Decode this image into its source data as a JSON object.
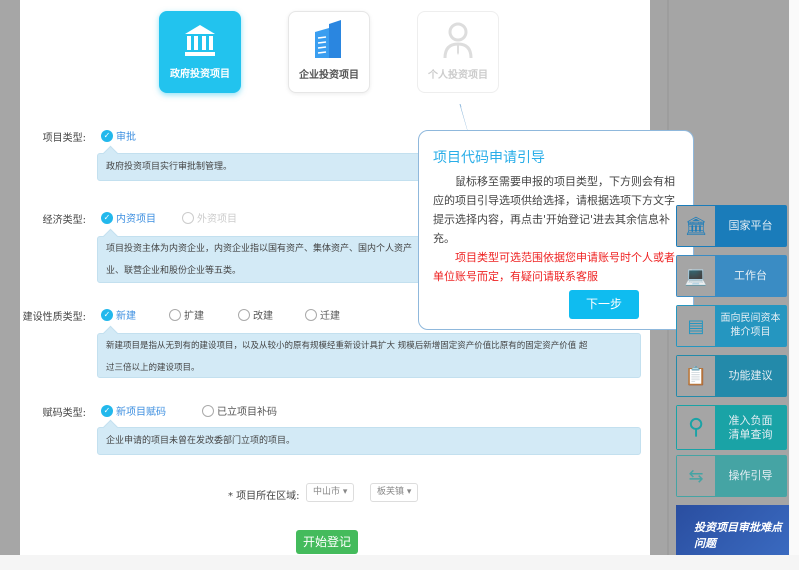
{
  "cards": [
    {
      "label": "政府投资项目",
      "icon": "government-building-icon",
      "active": true
    },
    {
      "label": "企业投资项目",
      "icon": "office-building-icon",
      "active": false
    },
    {
      "label": "个人投资项目",
      "icon": "person-icon",
      "active": false,
      "disabled": true
    }
  ],
  "form": {
    "project_type": {
      "label": "项目类型:",
      "options": [
        "审批"
      ],
      "selected": "审批",
      "desc": "政府投资项目实行审批制管理。"
    },
    "economy_type": {
      "label": "经济类型:",
      "options": [
        "内资项目",
        "外资项目"
      ],
      "selected": "内资项目",
      "desc_line1": "项目投资主体为内资企业，内资企业指以国有资产、集体资产、国内个人资产",
      "desc_line2": "业、联营企业和股份企业等五类。"
    },
    "construction_type": {
      "label": "建设性质类型:",
      "options": [
        "新建",
        "扩建",
        "改建",
        "迁建"
      ],
      "selected": "新建",
      "desc_line1": "新建项目是指从无到有的建设项目，以及从较小的原有规模经重新设计具扩大 规模后新增固定资产价值比原有的固定资产价值 超",
      "desc_line2": "过三倍以上的建设项目。"
    },
    "code_type": {
      "label": "赋码类型:",
      "options": [
        "新项目赋码",
        "已立项目补码"
      ],
      "selected": "新项目赋码",
      "desc": "企业申请的项目未曾在发改委部门立项的项目。"
    },
    "region": {
      "label": "* 项目所在区域:",
      "city": "中山市",
      "town": "板芙镇"
    },
    "start_button": "开始登记"
  },
  "popover": {
    "title": "项目代码申请引导",
    "body": "鼠标移至需要申报的项目类型，下方则会有相应的项目引导选项供给选择，请根据选项下方文字提示选择内容，再点击'开始登记'进去其余信息补充。",
    "warning": "项目类型可选范围依据您申请账号时个人或者单位账号而定，有疑问请联系客服",
    "next_button": "下一步"
  },
  "sidebar": [
    {
      "label": "国家平台",
      "icon": "bank-icon",
      "color": "#1a7cba"
    },
    {
      "label": "工作台",
      "icon": "computer-icon",
      "color": "#3a8cc4"
    },
    {
      "label": "面向民间资本推介项目",
      "icon": "promotion-icon",
      "color": "#2596c0"
    },
    {
      "label": "功能建议",
      "icon": "clipboard-icon",
      "color": "#238aaa"
    },
    {
      "label": "准入负面清单查询",
      "icon": "search-icon",
      "color": "#1aa3a6"
    },
    {
      "label": "操作引导",
      "icon": "signpost-icon",
      "color": "#45a4a4"
    }
  ],
  "banner": {
    "text": "投资项目审批难点问题"
  }
}
